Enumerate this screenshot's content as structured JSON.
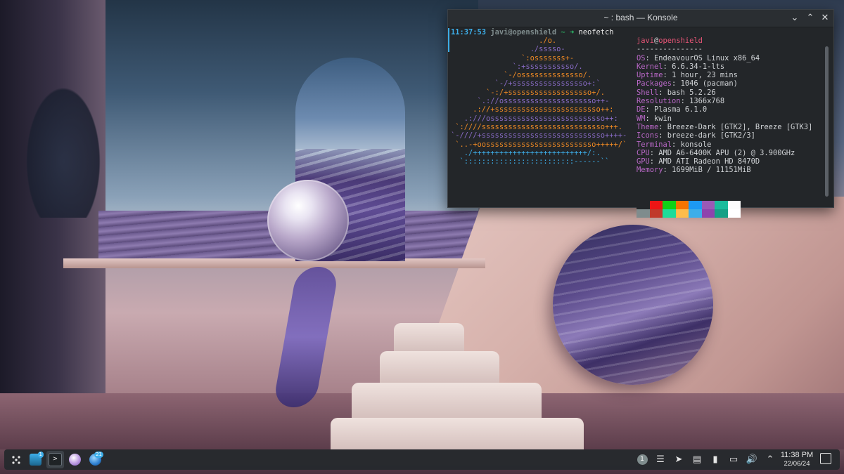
{
  "window": {
    "title": "~ : bash — Konsole",
    "minimize_glyph": "⌄",
    "maximize_glyph": "⌃",
    "close_glyph": "✕"
  },
  "terminal": {
    "prompt": {
      "time": "11:37:53",
      "user_host": "javi@openshield",
      "path": "~",
      "arrow": "➜",
      "command": "neofetch"
    },
    "logo_lines": [
      {
        "text": "                    ./o.",
        "color": "orange"
      },
      {
        "text": "                  ./sssso-",
        "color": "purple"
      },
      {
        "text": "                `:osssssss+-",
        "color": "orange"
      },
      {
        "text": "              `:+sssssssssso/.",
        "color": "purple"
      },
      {
        "text": "            `-/ossssssssssssso/.",
        "color": "orange"
      },
      {
        "text": "          `-/+sssssssssssssssso+:`",
        "color": "purple"
      },
      {
        "text": "        `-:/+sssssssssssssssssso+/.",
        "color": "orange"
      },
      {
        "text": "      `.://osssssssssssssssssssso++-",
        "color": "purple"
      },
      {
        "text": "     .://+ssssssssssssssssssssssso++:",
        "color": "orange"
      },
      {
        "text": "   .:///ossssssssssssssssssssssssso++:",
        "color": "purple"
      },
      {
        "text": " `:////ssssssssssssssssssssssssssso+++.",
        "color": "orange"
      },
      {
        "text": "`-////+ssssssssssssssssssssssssssso++++-",
        "color": "purple"
      },
      {
        "text": " `..-+oosssssssssssssssssssssssso+++++/`",
        "color": "orange"
      },
      {
        "text": "   ./++++++++++++++++++++++++++/:.",
        "color": "blue"
      },
      {
        "text": "  `:::::::::::::::::::::::::------``",
        "color": "blue"
      }
    ],
    "info": {
      "user": "javi",
      "at": "@",
      "host": "openshield",
      "separator": "---------------",
      "rows": [
        {
          "key": "OS",
          "value": "EndeavourOS Linux x86_64"
        },
        {
          "key": "Kernel",
          "value": "6.6.34-1-lts"
        },
        {
          "key": "Uptime",
          "value": "1 hour, 23 mins"
        },
        {
          "key": "Packages",
          "value": "1046 (pacman)"
        },
        {
          "key": "Shell",
          "value": "bash 5.2.26"
        },
        {
          "key": "Resolution",
          "value": "1366x768"
        },
        {
          "key": "DE",
          "value": "Plasma 6.1.0"
        },
        {
          "key": "WM",
          "value": "kwin"
        },
        {
          "key": "Theme",
          "value": "Breeze-Dark [GTK2], Breeze [GTK3]"
        },
        {
          "key": "Icons",
          "value": "breeze-dark [GTK2/3]"
        },
        {
          "key": "Terminal",
          "value": "konsole"
        },
        {
          "key": "CPU",
          "value": "AMD A6-6400K APU (2) @ 3.900GHz"
        },
        {
          "key": "GPU",
          "value": "AMD ATI Radeon HD 8470D"
        },
        {
          "key": "Memory",
          "value": "1699MiB / 11151MiB"
        }
      ]
    },
    "palette_top": [
      "#232629",
      "#ed1515",
      "#11d116",
      "#f67400",
      "#1d99f3",
      "#9b59b6",
      "#1abc9c",
      "#fcfcfc"
    ],
    "palette_bottom": [
      "#7f8c8d",
      "#c0392b",
      "#1cdc9a",
      "#fdbc4b",
      "#3daee9",
      "#8e44ad",
      "#16a085",
      "#ffffff"
    ],
    "colors": {
      "orange": "#f08a24",
      "purple": "#8a6cc8",
      "blue": "#3daee9"
    }
  },
  "taskbar": {
    "launcher_icon": "application-launcher-icon",
    "tasks": [
      {
        "name": "dolphin-file-manager-icon",
        "badge": "1"
      },
      {
        "name": "konsole-icon",
        "badge": ""
      },
      {
        "name": "app-circle-icon",
        "badge": ""
      },
      {
        "name": "app-globe-icon",
        "badge": "21"
      }
    ],
    "tray": {
      "update_badge": "1",
      "icons": [
        "updates-icon",
        "clipboard-manager-icon",
        "send-icon",
        "notes-icon",
        "usb-drive-icon",
        "network-icon",
        "volume-icon",
        "expand-tray-icon"
      ]
    },
    "clock": {
      "time": "11:38 PM",
      "date": "22/06/24"
    }
  }
}
